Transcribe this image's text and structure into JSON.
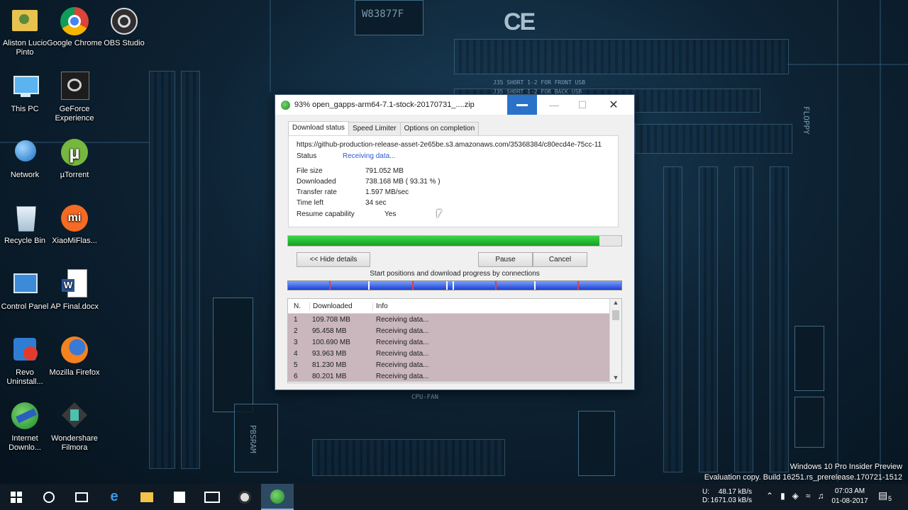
{
  "desktop": {
    "icons": [
      {
        "label": "Aliston Lucio Pinto",
        "icon": "user-folder-icon"
      },
      {
        "label": "Google Chrome",
        "icon": "chrome-icon"
      },
      {
        "label": "OBS Studio",
        "icon": "obs-icon"
      },
      {
        "label": "This PC",
        "icon": "computer-icon"
      },
      {
        "label": "GeForce Experience",
        "icon": "geforce-icon"
      },
      {
        "label": "Network",
        "icon": "network-icon"
      },
      {
        "label": "µTorrent",
        "icon": "utorrent-icon"
      },
      {
        "label": "Recycle Bin",
        "icon": "recycle-bin-icon"
      },
      {
        "label": "XiaoMiFlas...",
        "icon": "xiaomi-icon"
      },
      {
        "label": "Control Panel",
        "icon": "control-panel-icon"
      },
      {
        "label": "AP Final.docx",
        "icon": "word-icon"
      },
      {
        "label": "Revo Uninstall...",
        "icon": "revo-icon"
      },
      {
        "label": "Mozilla Firefox",
        "icon": "firefox-icon"
      },
      {
        "label": "Internet Downlo...",
        "icon": "idm-icon"
      },
      {
        "label": "Wondershare Filmora",
        "icon": "filmora-icon"
      }
    ],
    "board_text": {
      "chip1": "W83877F",
      "ce": "CE",
      "slot_label": "J35 SHORT 1-2 FOR FRONT USB",
      "slot_label2": "J35 SHORT 1-2 FOR BACK USB",
      "cpu_fan": "CPU-FAN",
      "floppy": "FLOPPY",
      "pbsram": "PBSRAM"
    }
  },
  "window": {
    "title": "93% open_gapps-arm64-7.1-stock-20170731_....zip",
    "tabs": [
      "Download status",
      "Speed Limiter",
      "Options on completion"
    ],
    "url": "https://github-production-release-asset-2e65be.s3.amazonaws.com/35368384/c80ecd4e-75cc-11",
    "status_label": "Status",
    "status_value": "Receiving data...",
    "fields": [
      {
        "label": "File size",
        "value": "791.052  MB"
      },
      {
        "label": "Downloaded",
        "value": "738.168  MB  ( 93.31 % )"
      },
      {
        "label": "Transfer rate",
        "value": "1.597  MB/sec"
      },
      {
        "label": "Time left",
        "value": "34 sec"
      },
      {
        "label": "Resume capability",
        "value": "Yes"
      }
    ],
    "progress_percent": 93.31,
    "buttons": {
      "hide_details": "<< Hide details",
      "pause": "Pause",
      "cancel": "Cancel"
    },
    "connections_label": "Start positions and download progress by connections",
    "table": {
      "headers": [
        "N.",
        "Downloaded",
        "Info"
      ],
      "rows": [
        {
          "n": "1",
          "downloaded": "109.708  MB",
          "info": "Receiving data..."
        },
        {
          "n": "2",
          "downloaded": "95.458  MB",
          "info": "Receiving data..."
        },
        {
          "n": "3",
          "downloaded": "100.690  MB",
          "info": "Receiving data..."
        },
        {
          "n": "4",
          "downloaded": "93.963  MB",
          "info": "Receiving data..."
        },
        {
          "n": "5",
          "downloaded": "81.230  MB",
          "info": "Receiving data..."
        },
        {
          "n": "6",
          "downloaded": "80.201  MB",
          "info": "Receiving data..."
        }
      ]
    },
    "colors": {
      "progress": "#13a21f",
      "connbar": "#1d3fd0",
      "row_bg": "#c9b7bd"
    }
  },
  "taskbar": {
    "net_up_label": "U:",
    "net_down_label": "D:",
    "net_up": "48.17 kB/s",
    "net_down": "1671.03 kB/s",
    "time": "07:03 AM",
    "date": "01-08-2017",
    "notifications": "5"
  },
  "watermark": {
    "line1": "Windows 10 Pro Insider Preview",
    "line2": "Evaluation copy. Build 16251.rs_prerelease.170721-1512"
  }
}
